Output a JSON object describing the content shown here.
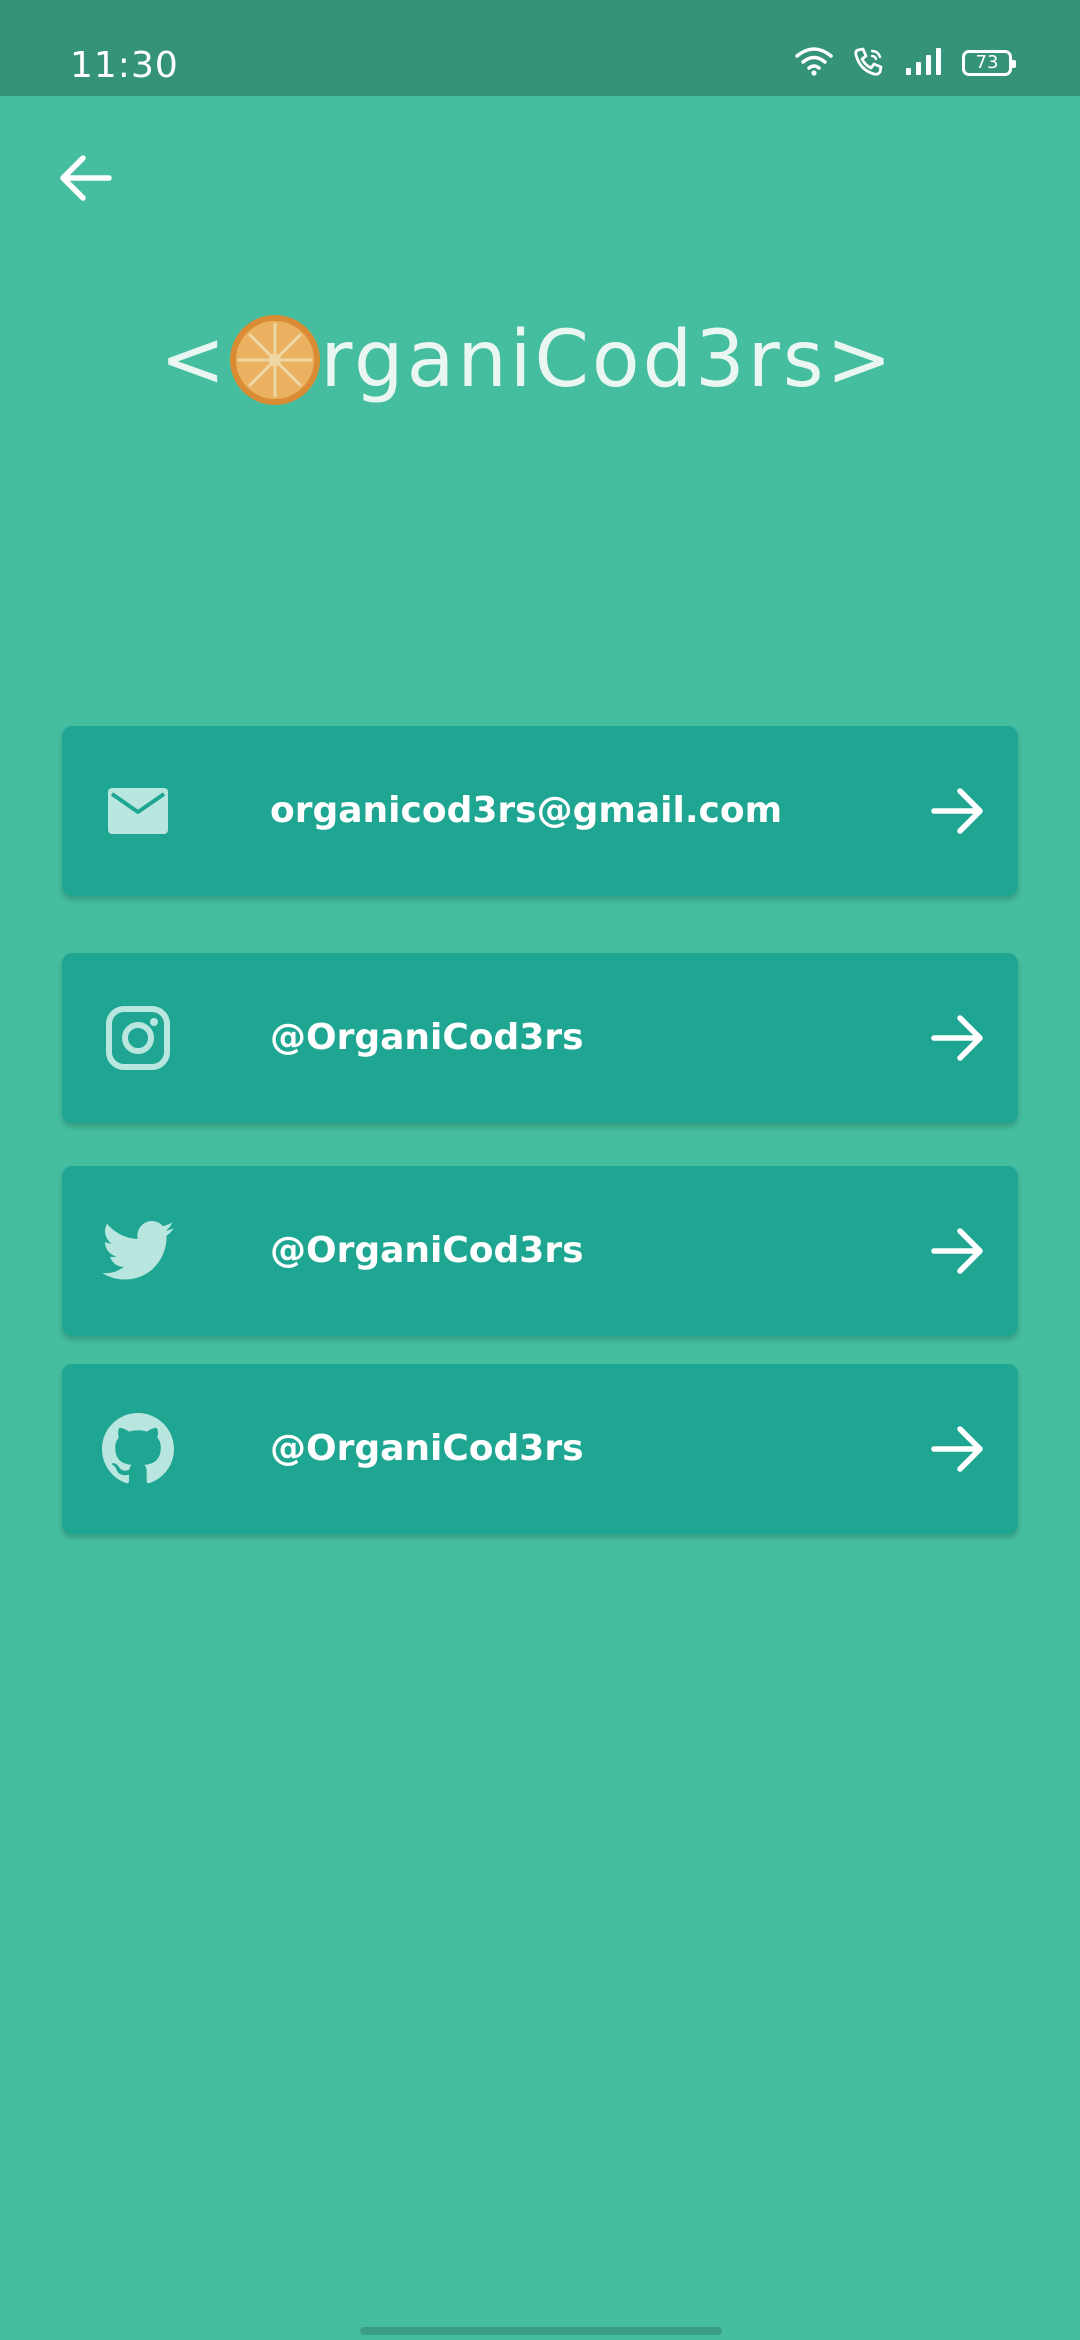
{
  "status_bar": {
    "time": "11:30",
    "battery_level": "73",
    "icons": [
      "wifi-icon",
      "wifi-call-icon",
      "signal-icon",
      "battery-icon"
    ]
  },
  "header": {
    "back_icon": "arrow-left-icon"
  },
  "logo": {
    "text_before": "<",
    "text_after": "rganiCod3rs>",
    "emblem": "orange-slice-icon"
  },
  "links": [
    {
      "icon": "mail-icon",
      "label": "organicod3rs@gmail.com",
      "arrow": "arrow-right-icon"
    },
    {
      "icon": "instagram-icon",
      "label": "@OrganiCod3rs",
      "arrow": "arrow-right-icon"
    },
    {
      "icon": "twitter-icon",
      "label": "@OrganiCod3rs",
      "arrow": "arrow-right-icon"
    },
    {
      "icon": "github-icon",
      "label": "@OrganiCod3rs",
      "arrow": "arrow-right-icon"
    }
  ],
  "colors": {
    "background": "#45be9f",
    "status_bar": "#349378",
    "card": "#1fa692",
    "icon_tint": "#b9e6df",
    "text": "#ffffff",
    "orange": "#f29b3a"
  }
}
